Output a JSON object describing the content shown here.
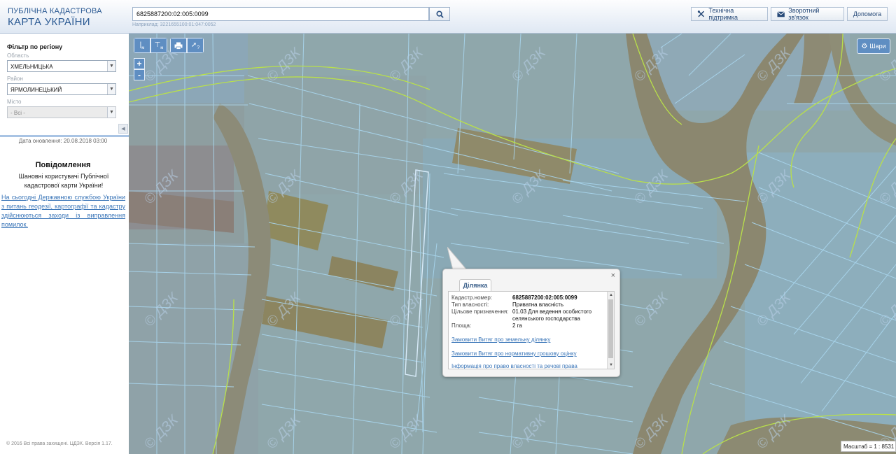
{
  "header": {
    "logo_line1": "ПУБЛІЧНА КАДАСТРОВА",
    "logo_line2": "КАРТА УКРАЇНИ",
    "search_value": "6825887200:02:005:0099",
    "search_example": "Наприклад: 3221655100:01:047:0052",
    "buttons": {
      "support": "Технічна підтримка",
      "feedback": "Зворотний зв'язок",
      "help": "Допомога"
    }
  },
  "sidebar": {
    "filter_title": "Фільтр по регіону",
    "oblast_label": "Область",
    "oblast_value": "ХМЕЛЬНИЦЬКА",
    "raion_label": "Район",
    "raion_value": "ЯРМОЛИНЕЦЬКИЙ",
    "city_label": "Місто",
    "city_value": "- Всі -",
    "updated": "Дата оновлення: 20.08.2018 03:00",
    "notice_title": "Повідомлення",
    "notice_greeting": "Шановні користувачі Публічної кадастрової карти України!",
    "notice_link": "На сьогодні Державною службою України з питань геодезії, картографії та кадастру здійснюються заходи із виправлення помилок.",
    "copyright": "© 2016 Всі права захищені. ЦДЗК. Версія 1.17."
  },
  "map": {
    "layers_label": "Шари",
    "zoom_in": "+",
    "zoom_out": "-",
    "scale": "Масштаб = 1 : 8531",
    "watermark": "© ДЗК",
    "tools": {
      "measure_line": "м",
      "measure_area": "м",
      "identify": "?"
    }
  },
  "popup": {
    "tab_label": "Ділянка",
    "close": "×",
    "rows": {
      "cadnum_key": "Кадастр.номер:",
      "cadnum_val": "6825887200:02:005:0099",
      "ownership_key": "Тип власності:",
      "ownership_val": "Приватна власність",
      "purpose_key": "Цільове призначення:",
      "purpose_val": "01.03 Для ведення особистого селянського господарства",
      "area_key": "Площа:",
      "area_val": "2 га"
    },
    "links": {
      "extract": "Замовити Витяг про земельну ділянку",
      "valuation": "Замовити Витяг про нормативну грошову оцінку",
      "rights": "Інформація про право власності та речові права"
    }
  }
}
